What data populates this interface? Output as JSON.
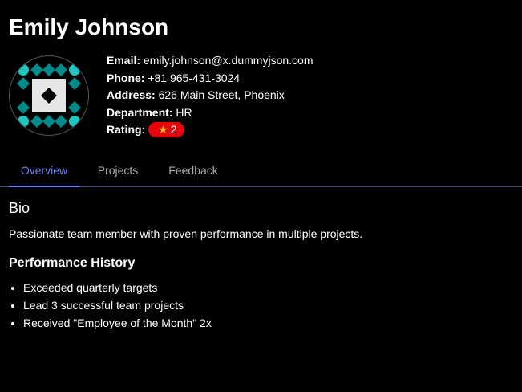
{
  "profile": {
    "name": "Emily Johnson",
    "avatar_icon": "identicon-avatar",
    "avatar_colors": {
      "primary": "#008b8b",
      "secondary": "#20c5c0",
      "center": "#e6e6e6",
      "ring": "#555555"
    }
  },
  "info": {
    "email_label": "Email:",
    "email": "emily.johnson@x.dummyjson.com",
    "phone_label": "Phone:",
    "phone": "+81 965-431-3024",
    "address_label": "Address:",
    "address": "626 Main Street, Phoenix",
    "department_label": "Department:",
    "department": "HR",
    "rating_label": "Rating:",
    "rating_icon": "star-icon",
    "rating_value": "2",
    "rating_badge_color": "#e8000b"
  },
  "tabs": [
    {
      "label": "Overview",
      "active": true
    },
    {
      "label": "Projects",
      "active": false
    },
    {
      "label": "Feedback",
      "active": false
    }
  ],
  "accent_color": "#6c7ef5",
  "overview": {
    "bio_title": "Bio",
    "bio_text": "Passionate team member with proven performance in multiple projects.",
    "performance_title": "Performance History",
    "performance_items": [
      "Exceeded quarterly targets",
      "Lead 3 successful team projects",
      "Received \"Employee of the Month\" 2x"
    ]
  }
}
